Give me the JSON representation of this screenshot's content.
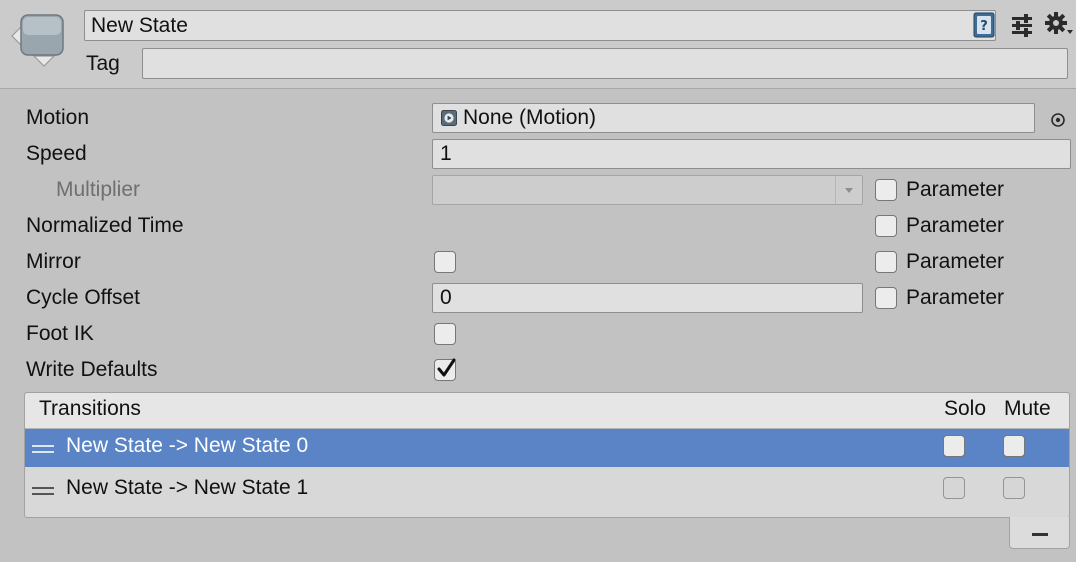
{
  "header": {
    "name_value": "New State",
    "tag_label": "Tag",
    "tag_value": ""
  },
  "fields": {
    "motion": {
      "label": "Motion",
      "value": "None (Motion)"
    },
    "speed": {
      "label": "Speed",
      "value": "1"
    },
    "multiplier": {
      "label": "Multiplier",
      "value": "",
      "parameter_label": "Parameter"
    },
    "normalized_time": {
      "label": "Normalized Time",
      "parameter_label": "Parameter"
    },
    "mirror": {
      "label": "Mirror",
      "parameter_label": "Parameter"
    },
    "cycle_offset": {
      "label": "Cycle Offset",
      "value": "0",
      "parameter_label": "Parameter"
    },
    "foot_ik": {
      "label": "Foot IK"
    },
    "write_defaults": {
      "label": "Write Defaults"
    }
  },
  "transitions": {
    "header": "Transitions",
    "solo_label": "Solo",
    "mute_label": "Mute",
    "rows": [
      {
        "label": "New State -> New State 0"
      },
      {
        "label": "New State -> New State 1"
      }
    ]
  },
  "icons": [
    "state-icon",
    "help-book-icon",
    "preset-sliders-icon",
    "gear-icon",
    "object-picker-icon",
    "motion-clip-icon",
    "dropdown-arrow-icon",
    "checkmark-icon",
    "drag-handle-icon",
    "minus-icon"
  ],
  "colors": {
    "background": "#c2c2c2",
    "header_background": "#cbcbcb",
    "field_background": "#e0e0e0",
    "selection": "#5a84c6"
  }
}
